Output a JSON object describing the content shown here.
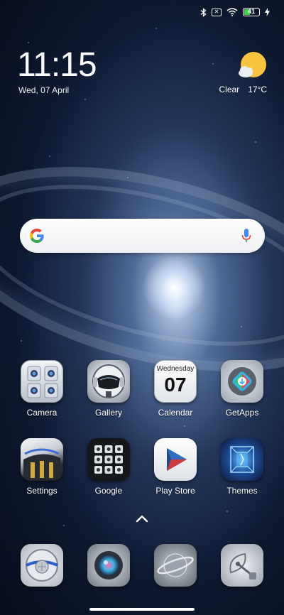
{
  "status_bar": {
    "icons": [
      "bluetooth-icon",
      "no-sim-icon",
      "wifi-icon",
      "battery-icon",
      "charging-icon"
    ],
    "battery_level": "41",
    "battery_fraction": 0.41
  },
  "clock_widget": {
    "time": "11:15",
    "date": "Wed, 07 April"
  },
  "weather_widget": {
    "condition": "Clear",
    "temperature": "17°C",
    "icon": "sun-cloud-icon"
  },
  "search_bar": {
    "logo": "google-g-icon",
    "mic": "mic-icon"
  },
  "apps": [
    {
      "label": "Camera",
      "icon": "camera-icon"
    },
    {
      "label": "Gallery",
      "icon": "gallery-icon"
    },
    {
      "label": "Calendar",
      "icon": "calendar-icon",
      "weekday": "Wednesday",
      "day": "07"
    },
    {
      "label": "GetApps",
      "icon": "getapps-icon"
    },
    {
      "label": "Settings",
      "icon": "settings-icon"
    },
    {
      "label": "Google",
      "icon": "google-folder-icon"
    },
    {
      "label": "Play Store",
      "icon": "play-store-icon"
    },
    {
      "label": "Themes",
      "icon": "themes-icon"
    }
  ],
  "dock": [
    {
      "icon": "phone-icon"
    },
    {
      "icon": "messages-icon"
    },
    {
      "icon": "browser-icon"
    },
    {
      "icon": "satellite-icon"
    }
  ],
  "colors": {
    "battery": "#41d14a",
    "google_blue": "#4285F4",
    "google_red": "#EA4335",
    "google_yellow": "#FBBC05",
    "google_green": "#34A853"
  }
}
